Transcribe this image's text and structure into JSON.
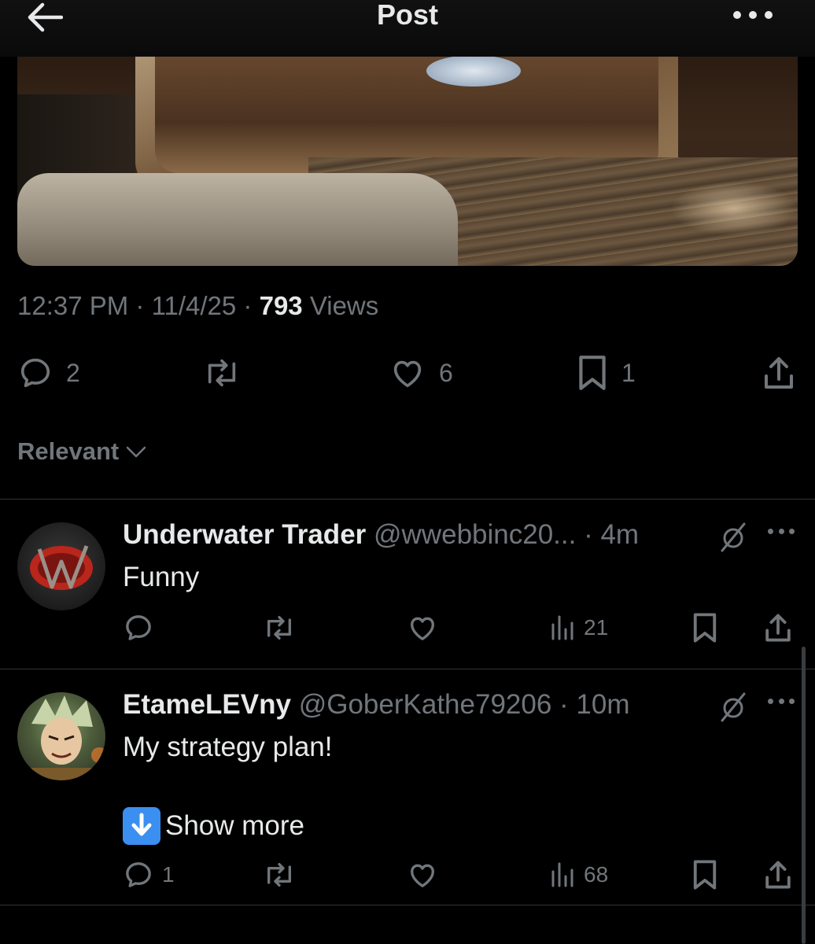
{
  "header": {
    "title": "Post"
  },
  "post": {
    "time": "12:37 PM",
    "date": "11/4/25",
    "views_count": "793",
    "views_label": "Views",
    "replies": "2",
    "likes": "6",
    "bookmarks": "1"
  },
  "sort": {
    "label": "Relevant"
  },
  "replies": [
    {
      "name": "Underwater Trader",
      "handle": "@wwebbinc20...",
      "time": "4m",
      "text": "Funny",
      "reply_count": "",
      "views": "21"
    },
    {
      "name": "EtameLEVny",
      "handle": "@GoberKathe79206",
      "time": "10m",
      "text": "My strategy plan!",
      "show_more": "Show more",
      "reply_count": "1",
      "views": "68"
    }
  ],
  "colors": {
    "background": "#000000",
    "text": "#e7e9ea",
    "muted": "#71767b",
    "divider": "#2f3336"
  }
}
